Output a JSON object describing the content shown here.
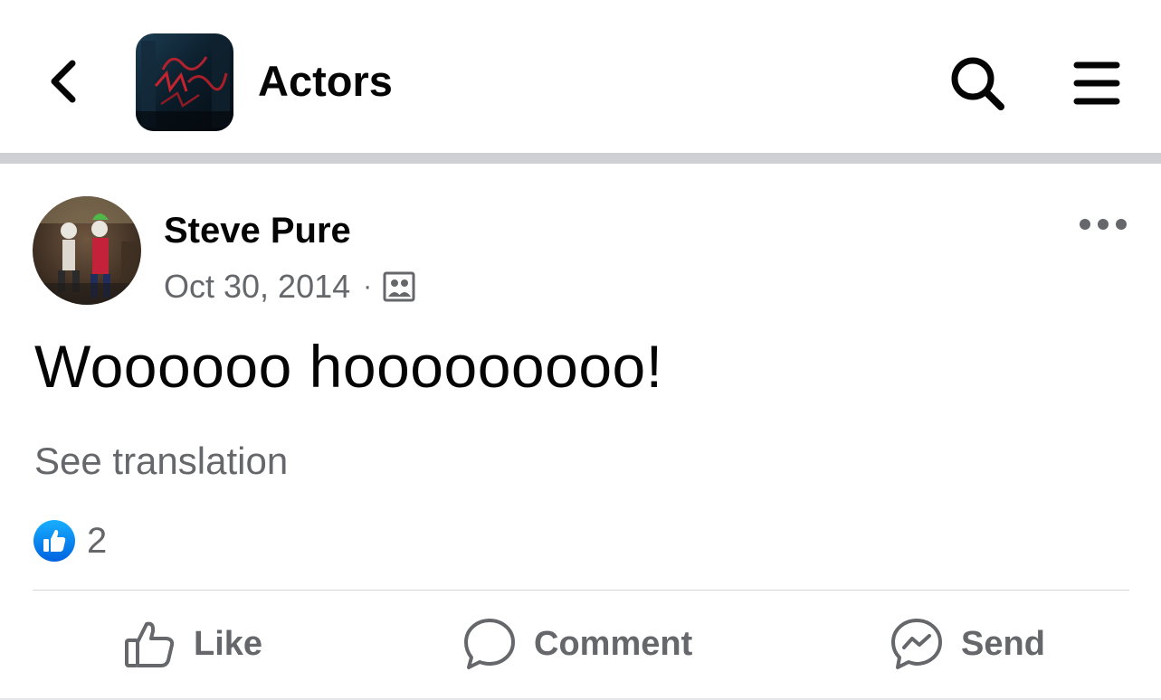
{
  "header": {
    "title": "Actors",
    "back_icon": "chevron-left-icon",
    "search_icon": "search-icon",
    "menu_icon": "hamburger-menu-icon"
  },
  "post": {
    "author": "Steve Pure",
    "date": "Oct 30, 2014",
    "separator": "·",
    "audience_icon": "group-members-icon",
    "more_icon": "more-dots-icon",
    "text": "Woooooo hooooooooo!",
    "see_translation": "See translation",
    "reaction_count": "2",
    "reaction_icon": "like-reaction-icon"
  },
  "actions": {
    "like": "Like",
    "comment": "Comment",
    "send": "Send"
  },
  "colors": {
    "text_primary": "#050505",
    "text_secondary": "#65676b",
    "like_blue": "#1877f2",
    "divider_band": "#ced0d4"
  }
}
